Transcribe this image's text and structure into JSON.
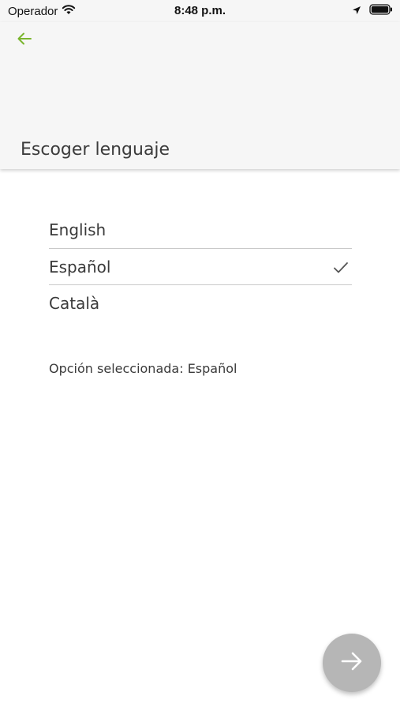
{
  "status_bar": {
    "carrier": "Operador",
    "time": "8:48 p.m."
  },
  "header": {
    "title": "Escoger lenguaje",
    "back_icon": "arrow-left-icon",
    "accent_color": "#7ab52e"
  },
  "languages": [
    {
      "label": "English",
      "selected": false
    },
    {
      "label": "Español",
      "selected": true
    },
    {
      "label": "Català",
      "selected": false
    }
  ],
  "selection_text": "Opción seleccionada: Español",
  "next_button": {
    "icon": "arrow-right-icon",
    "color": "#b6b6b6"
  }
}
